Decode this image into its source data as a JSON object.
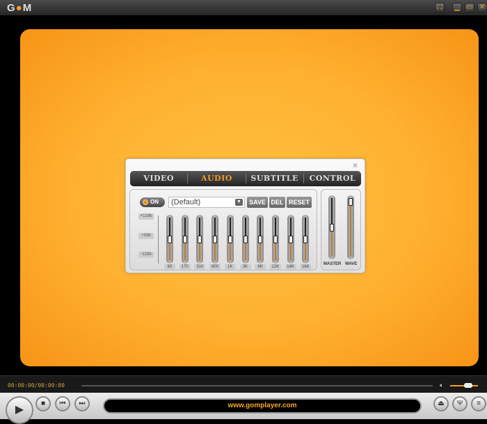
{
  "titlebar": {
    "logo": "GOM",
    "buttons": [
      "fullscreen",
      "minimize",
      "maximize",
      "close"
    ]
  },
  "panel": {
    "close": "×",
    "tabs": [
      "VIDEO",
      "AUDIO",
      "SUBTITLE",
      "CONTROL"
    ],
    "active_tab": "AUDIO",
    "eq": {
      "on_label": "ON",
      "preset": "(Default)",
      "save": "SAVE",
      "del": "DEL",
      "reset": "RESET",
      "db_labels": [
        "+12db",
        "+0db",
        "-12db"
      ],
      "bands": [
        {
          "label": "60",
          "value": 0
        },
        {
          "label": "170",
          "value": 0
        },
        {
          "label": "310",
          "value": 0
        },
        {
          "label": "600",
          "value": 0
        },
        {
          "label": "1K",
          "value": 0
        },
        {
          "label": "3K",
          "value": 0
        },
        {
          "label": "6K",
          "value": 0
        },
        {
          "label": "12K",
          "value": 0
        },
        {
          "label": "14K",
          "value": 0
        },
        {
          "label": "16K",
          "value": 0
        }
      ]
    },
    "mixer": {
      "master_label": "MASTER",
      "wave_label": "WAVE",
      "master_level": 0.5,
      "wave_level": 1.0
    }
  },
  "controls": {
    "time": "00:00:00/00:00:00",
    "volume_level": 0.65,
    "display_text": "www.gomplayer.com"
  }
}
